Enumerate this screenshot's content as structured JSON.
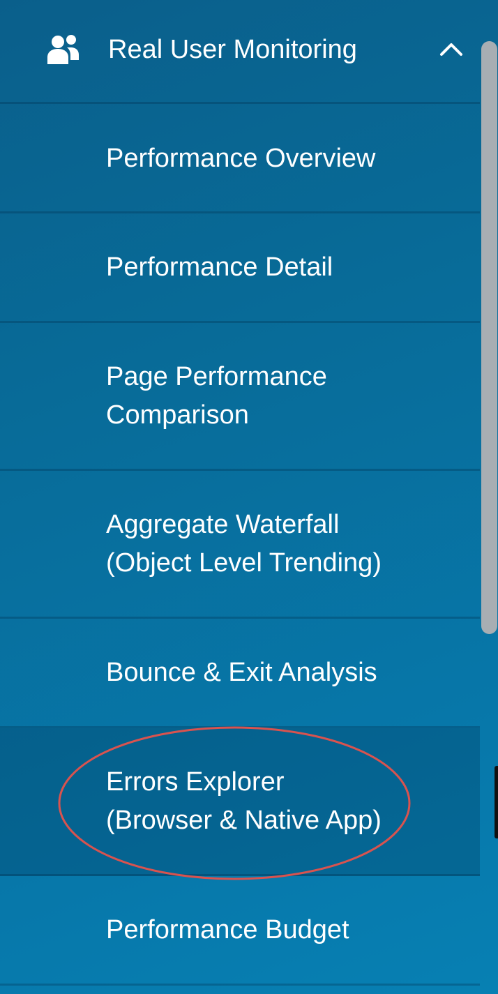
{
  "nav": {
    "header": {
      "label": "Real User Monitoring",
      "icon": "users-icon",
      "toggle_icon": "chevron-up-icon",
      "expanded": true
    },
    "items": [
      {
        "label_lines": [
          "Performance Overview"
        ]
      },
      {
        "label_lines": [
          "Performance Detail"
        ]
      },
      {
        "label_lines": [
          "Page Performance",
          "Comparison"
        ]
      },
      {
        "label_lines": [
          "Aggregate Waterfall",
          "(Object Level Trending)"
        ]
      },
      {
        "label_lines": [
          "Bounce & Exit Analysis"
        ]
      },
      {
        "label_lines": [
          "Errors Explorer",
          "(Browser & Native App)"
        ],
        "active": true,
        "annotated": true
      },
      {
        "label_lines": [
          "Performance Budget"
        ]
      }
    ]
  },
  "colors": {
    "background_start": "#0a5f8b",
    "background_end": "#0780b3",
    "text": "#ffffff",
    "annotation": "#d9534f",
    "scroll_thumb": "#a8aeb3"
  }
}
